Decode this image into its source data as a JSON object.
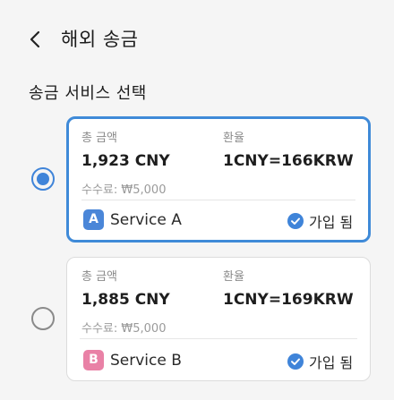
{
  "header": {
    "title": "해외 송금"
  },
  "section": {
    "title": "송금 서비스 선택"
  },
  "colors": {
    "accent": "#3f84d9",
    "badge_a": "#4a86d8",
    "badge_b": "#e981a6"
  },
  "services": [
    {
      "selected": true,
      "total_label": "총 금액",
      "rate_label": "환율",
      "amount": "1,923 CNY",
      "rate": "1CNY=166KRW",
      "fee": "수수료: ₩5,000",
      "badge": "A",
      "name": "Service A",
      "status": "가입 됨"
    },
    {
      "selected": false,
      "total_label": "총 금액",
      "rate_label": "환율",
      "amount": "1,885 CNY",
      "rate": "1CNY=169KRW",
      "fee": "수수료: ₩5,000",
      "badge": "B",
      "name": "Service B",
      "status": "가입 됨"
    }
  ]
}
